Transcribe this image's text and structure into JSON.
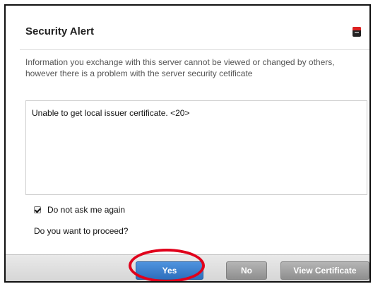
{
  "dialog": {
    "title": "Security Alert",
    "info_text": "Information you exchange with this server cannot be viewed or changed by others, however there is a problem with the server security cetificate",
    "message": "Unable to get local issuer certificate. <20>",
    "checkbox_label": "Do not ask me again",
    "checkbox_checked": true,
    "question": "Do you want to proceed?",
    "buttons": {
      "yes": "Yes",
      "no": "No",
      "view": "View Certificate"
    },
    "close_icon": "close-icon"
  }
}
